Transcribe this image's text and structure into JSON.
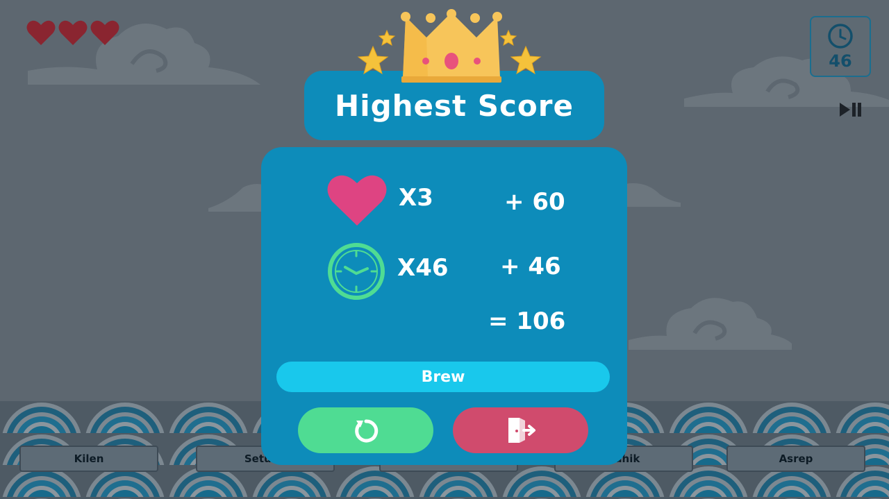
{
  "hud": {
    "lives": 3,
    "lives_icon": "heart-icon",
    "timer_value": "46",
    "timer_icon": "clock-icon",
    "skip_icon": "play-pause-icon"
  },
  "dialog": {
    "title": "Highest Score",
    "crown_icon": "crown-icon",
    "rows": [
      {
        "icon": "heart-icon",
        "multiplier": "X3",
        "points": "+ 60"
      },
      {
        "icon": "clock-icon",
        "multiplier": "X46",
        "points": "+ 46"
      }
    ],
    "total": "= 106",
    "player_name": "Brew",
    "retry_icon": "retry-icon",
    "exit_icon": "exit-icon"
  },
  "bottom_buttons": [
    {
      "label": "Kilen"
    },
    {
      "label": "Setung"
    },
    {
      "label": ""
    },
    {
      "label": "edhik"
    },
    {
      "label": "Asrep"
    }
  ],
  "colors": {
    "background": "#5d6770",
    "panel": "#0d8cba",
    "name_bar": "#19c8ec",
    "retry": "#4fdc93",
    "exit": "#d04b6d",
    "heart_pink": "#de4482",
    "clock_green": "#4fdc93",
    "crown_gold": "#f7c55a"
  }
}
